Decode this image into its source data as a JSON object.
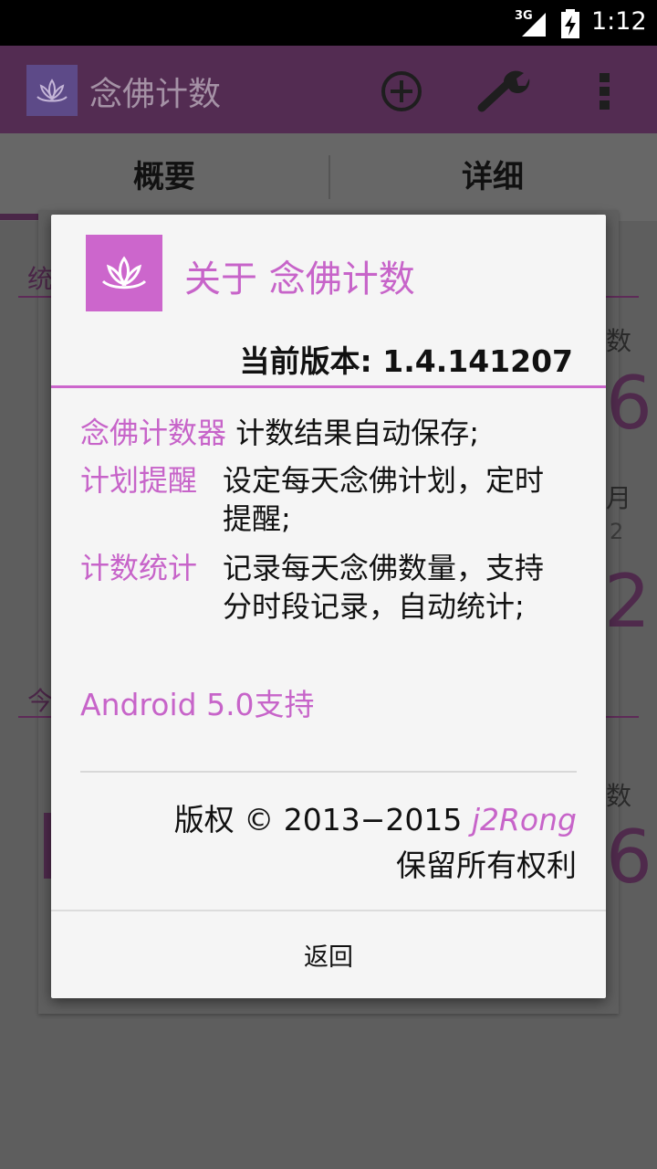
{
  "status_bar": {
    "network": "3G",
    "time": "1:12"
  },
  "app_bar": {
    "title": "念佛计数",
    "icons": [
      "lotus-icon",
      "add-icon",
      "wrench-icon",
      "overflow-icon"
    ]
  },
  "tabs": [
    {
      "label": "概要",
      "selected": true
    },
    {
      "label": "详细",
      "selected": false
    }
  ],
  "background": {
    "section1": "统",
    "count_label_1": "数",
    "month_label": "月",
    "small_value": "2",
    "section2": "今",
    "count_label_2": "数"
  },
  "dialog": {
    "title": "关于 念佛计数",
    "version": "当前版本: 1.4.141207",
    "features": [
      {
        "label": "念佛计数器",
        "desc": "计数结果自动保存;"
      },
      {
        "label": "计划提醒",
        "desc": "设定每天念佛计划，定时提醒;"
      },
      {
        "label": "计数统计",
        "desc": "记录每天念佛数量，支持分时段记录，自动统计;"
      }
    ],
    "android_support": "Android 5.0支持",
    "copyright_prefix": "版权 © 2013−2015",
    "author": "j2Rong",
    "rights": "保留所有权利",
    "back_label": "返回"
  },
  "colors": {
    "accent": "#cc66cc",
    "app_bar": "#8e4a8c",
    "status_bar": "#000000"
  }
}
